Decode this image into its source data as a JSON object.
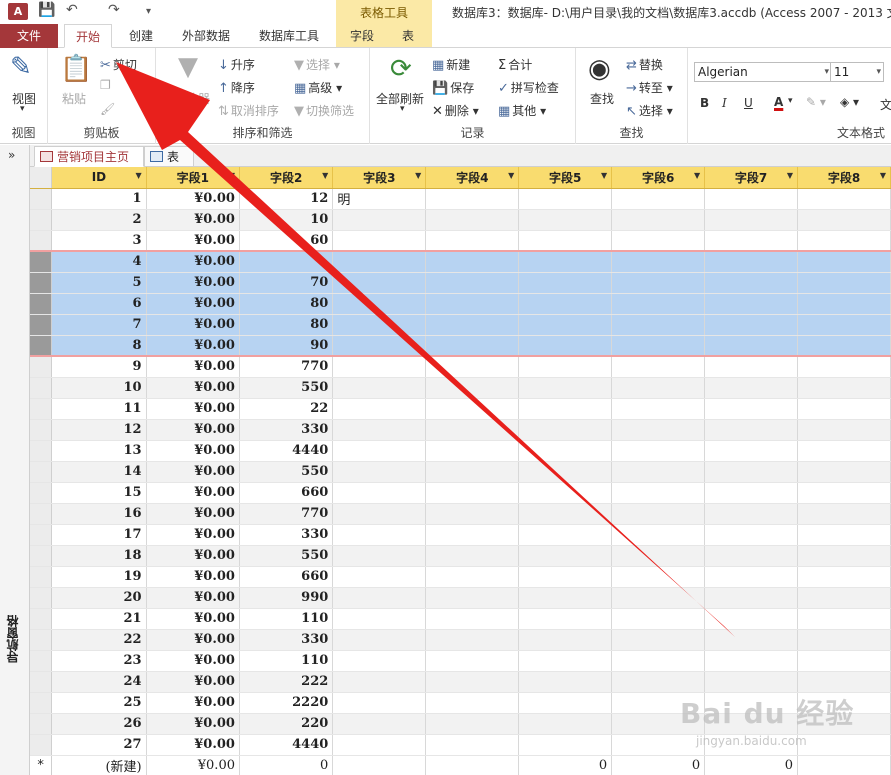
{
  "titlebar": {
    "logo": "A",
    "tools_label": "表格工具",
    "window_title": "数据库3：数据库- D:\\用户目录\\我的文档\\数据库3.accdb (Access 2007 - 2013 文"
  },
  "tabs": {
    "file": "文件",
    "items": [
      "开始",
      "创建",
      "外部数据",
      "数据库工具",
      "字段",
      "表"
    ]
  },
  "ribbon": {
    "view": {
      "button": "视图",
      "group": "视图"
    },
    "clipboard": {
      "paste": "粘贴",
      "cut": "剪切",
      "group": "剪贴板"
    },
    "sort": {
      "filter": "筛选器",
      "asc": "升序",
      "desc": "降序",
      "clear_sort": "取消排序",
      "select": "选择",
      "advanced": "高级",
      "toggle_filter": "切换筛选",
      "group": "排序和筛选"
    },
    "records": {
      "refresh": "全部刷新",
      "new": "新建",
      "save": "保存",
      "delete": "删除",
      "totals": "合计",
      "spelling": "拼写检查",
      "more": "其他",
      "group": "记录"
    },
    "find": {
      "find": "查找",
      "replace": "替换",
      "goto": "转至",
      "select": "选择",
      "group": "查找"
    },
    "text": {
      "font": "Algerian",
      "size": "11",
      "bold": "B",
      "italic": "I",
      "underline": "U",
      "font_color": "A",
      "overflow": "文",
      "group": "文本格式"
    }
  },
  "nav": {
    "toggle": "»",
    "label": "导航窗格"
  },
  "doctabs": [
    "营销项目主页",
    "表"
  ],
  "grid": {
    "columns": [
      "ID",
      "字段1",
      "字段2",
      "字段3",
      "字段4",
      "字段5",
      "字段6",
      "字段7",
      "字段8"
    ],
    "rows": [
      [
        "1",
        "¥0.00",
        "12",
        "明"
      ],
      [
        "2",
        "¥0.00",
        "10",
        ""
      ],
      [
        "3",
        "¥0.00",
        "60",
        ""
      ],
      [
        "4",
        "¥0.00",
        "",
        ""
      ],
      [
        "5",
        "¥0.00",
        "70",
        ""
      ],
      [
        "6",
        "¥0.00",
        "80",
        ""
      ],
      [
        "7",
        "¥0.00",
        "80",
        ""
      ],
      [
        "8",
        "¥0.00",
        "90",
        ""
      ],
      [
        "9",
        "¥0.00",
        "770",
        ""
      ],
      [
        "10",
        "¥0.00",
        "550",
        ""
      ],
      [
        "11",
        "¥0.00",
        "22",
        ""
      ],
      [
        "12",
        "¥0.00",
        "330",
        ""
      ],
      [
        "13",
        "¥0.00",
        "4440",
        ""
      ],
      [
        "14",
        "¥0.00",
        "550",
        ""
      ],
      [
        "15",
        "¥0.00",
        "660",
        ""
      ],
      [
        "16",
        "¥0.00",
        "770",
        ""
      ],
      [
        "17",
        "¥0.00",
        "330",
        ""
      ],
      [
        "18",
        "¥0.00",
        "550",
        ""
      ],
      [
        "19",
        "¥0.00",
        "660",
        ""
      ],
      [
        "20",
        "¥0.00",
        "990",
        ""
      ],
      [
        "21",
        "¥0.00",
        "110",
        ""
      ],
      [
        "22",
        "¥0.00",
        "330",
        ""
      ],
      [
        "23",
        "¥0.00",
        "110",
        ""
      ],
      [
        "24",
        "¥0.00",
        "222",
        ""
      ],
      [
        "25",
        "¥0.00",
        "2220",
        ""
      ],
      [
        "26",
        "¥0.00",
        "220",
        ""
      ],
      [
        "27",
        "¥0.00",
        "4440",
        ""
      ]
    ],
    "selected_ids": [
      "4",
      "5",
      "6",
      "7",
      "8"
    ],
    "new_row": {
      "marker": "*",
      "id": "(新建)",
      "f1": "¥0.00",
      "f2": "0",
      "f5": "0",
      "f6": "0",
      "f7": "0"
    }
  },
  "watermark": {
    "logo": "Bai du 经验",
    "url": "jingyan.baidu.com"
  },
  "colors": {
    "accent": "#a4373a",
    "header": "#f9dc6f",
    "selection": "#b7d3f2",
    "arrow": "#e8201c"
  }
}
